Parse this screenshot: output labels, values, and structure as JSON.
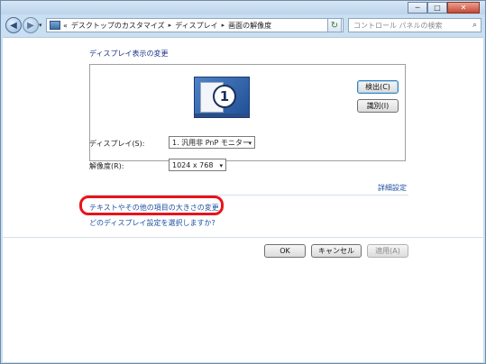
{
  "window": {
    "buttons": {
      "minimize": "─",
      "maximize": "□",
      "close": "✕"
    }
  },
  "nav": {
    "breadcrumb": [
      "«",
      "デスクトップのカスタマイズ",
      "ディスプレイ",
      "画面の解像度"
    ],
    "search_placeholder": "コントロール パネルの検索"
  },
  "page": {
    "title": "ディスプレイ表示の変更",
    "monitor_number": "1",
    "detect_button": "検出(C)",
    "identify_button": "識別(I)",
    "display_label": "ディスプレイ(S):",
    "display_value": "1. 汎用非 PnP モニター",
    "resolution_label": "解像度(R):",
    "resolution_value": "1024 x 768",
    "advanced_link": "詳細設定",
    "text_size_link": "テキストやその他の項目の大きさの変更",
    "which_settings_link": "どのディスプレイ設定を選択しますか?",
    "ok_button": "OK",
    "cancel_button": "キャンセル",
    "apply_button": "適用(A)"
  },
  "colors": {
    "link": "#1e50a2",
    "title": "#1e3287",
    "highlight": "#e8141b"
  }
}
